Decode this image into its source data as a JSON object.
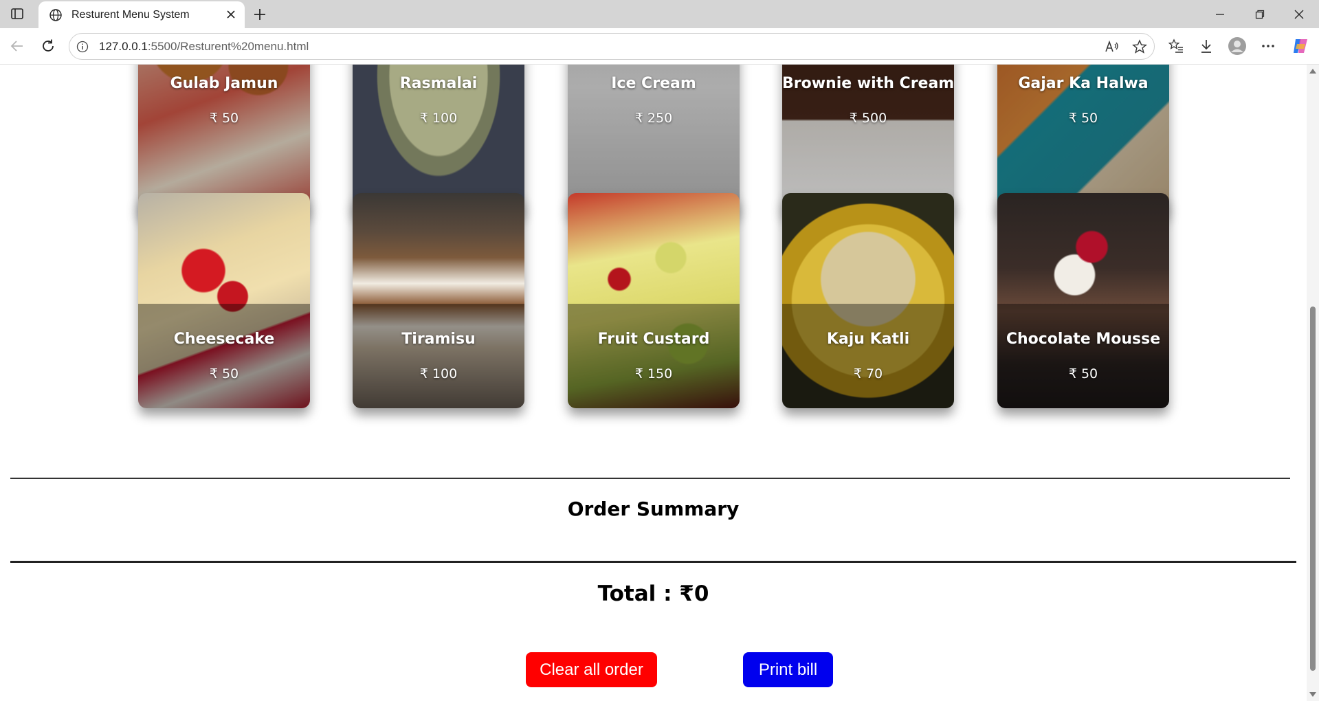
{
  "browser": {
    "tab_title": "Resturent Menu System",
    "url_host": "127.0.0.1",
    "url_rest": ":5500/Resturent%20menu.html",
    "icons": [
      "sidebar-toggle-icon",
      "globe-icon",
      "close-icon",
      "plus-icon",
      "minimize-icon",
      "restore-icon",
      "window-close-icon",
      "back-icon",
      "refresh-icon",
      "info-icon",
      "read-aloud-icon",
      "favorite-star-icon",
      "favorites-list-icon",
      "download-icon",
      "profile-icon",
      "more-icon",
      "copilot-icon"
    ]
  },
  "menu": {
    "top_row": [
      {
        "name": "Gulab Jamun",
        "price": "₹ 50"
      },
      {
        "name": "Rasmalai",
        "price": "₹ 100"
      },
      {
        "name": "Ice Cream",
        "price": "₹ 250"
      },
      {
        "name": "Brownie with Cream",
        "price": "₹ 500"
      },
      {
        "name": "Gajar Ka Halwa",
        "price": "₹ 50"
      }
    ],
    "bottom_row": [
      {
        "name": "Cheesecake",
        "price": "₹ 50"
      },
      {
        "name": "Tiramisu",
        "price": "₹ 100"
      },
      {
        "name": "Fruit Custard",
        "price": "₹ 150"
      },
      {
        "name": "Kaju Katli",
        "price": "₹ 70"
      },
      {
        "name": "Chocolate Mousse",
        "price": "₹ 50"
      }
    ]
  },
  "order": {
    "title": "Order Summary",
    "total_label": "Total : ₹0"
  },
  "buttons": {
    "clear": "Clear all order",
    "print": "Print bill"
  },
  "colors": {
    "clear_button": "#ff0000",
    "print_button": "#0000ee"
  }
}
